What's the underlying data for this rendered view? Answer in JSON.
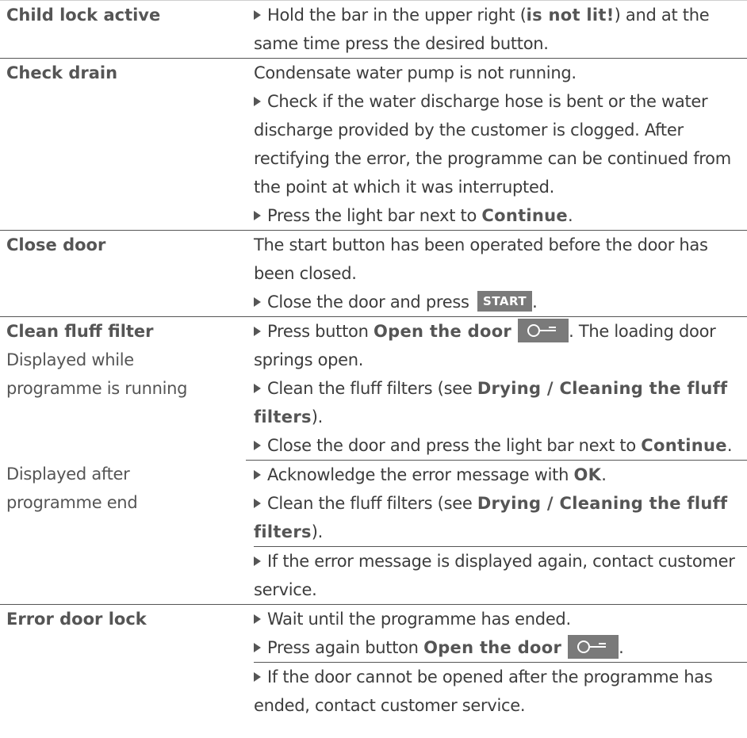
{
  "rows": [
    {
      "key": "child_lock",
      "left": [
        "Child lock active"
      ],
      "right": {
        "bullet1_pre": "Hold the bar in the upper right (",
        "bullet1_bold": "is not lit!",
        "bullet1_post": ") and at the",
        "cont1": "same time press the desired button."
      }
    },
    {
      "key": "check_drain",
      "left": [
        "Check drain"
      ],
      "right": {
        "intro": "Condensate water pump is not running.",
        "bullet1": "Check if the water discharge hose is bent or the water",
        "cont1": "discharge provided by the customer is clogged. After",
        "cont2": "rectifying the error, the programme can be continued from",
        "cont3": "the point at which it was interrupted.",
        "bullet2_pre": "Press the light bar next to ",
        "bullet2_bold": "Continue",
        "bullet2_post": "."
      }
    },
    {
      "key": "close_door",
      "left": [
        "Close door"
      ],
      "right": {
        "intro1": "The start button has been operated before the door has",
        "intro2": "been closed.",
        "bullet1_pre": "Close the door and press ",
        "start_label": "START",
        "bullet1_post": "."
      }
    },
    {
      "key": "clean_fluff",
      "left": [
        "Clean fluff filter",
        "Displayed while",
        "programme is running"
      ],
      "right": {
        "bullet1_pre": "Press button ",
        "bullet1_bold": "Open the door",
        "bullet1_post": ". The loading door",
        "cont1": "springs open.",
        "bullet2_pre": "Clean the fluff filters (see ",
        "bullet2_bold": "Drying / Cleaning the fluff",
        "cont2_bold": "filters",
        "cont2_post": ").",
        "bullet3_pre": "Close the door and press the light bar next to ",
        "bullet3_bold": "Continue",
        "bullet3_post": "."
      }
    },
    {
      "key": "after_end",
      "left": [
        "Displayed after",
        "programme end"
      ],
      "right": {
        "bullet1_pre": "Acknowledge the error message with ",
        "bullet1_bold": "OK",
        "bullet1_post": ".",
        "bullet2_pre": "Clean the fluff filters (see ",
        "bullet2_bold": "Drying / Cleaning the fluff",
        "cont2_bold": "filters",
        "cont2_post": ").",
        "bullet3": "If the error message is displayed again, contact customer",
        "cont3": "service."
      }
    },
    {
      "key": "error_door_lock",
      "left": [
        "Error door lock"
      ],
      "right": {
        "bullet1": "Wait until the programme has ended.",
        "bullet2_pre": "Press again button ",
        "bullet2_bold": "Open the door",
        "bullet2_post": ".",
        "bullet3": "If the door cannot be opened after the programme has",
        "cont3": "ended, contact customer service."
      }
    }
  ],
  "colors": {
    "text": "#3c3c3c",
    "bold_keyword": "#555555",
    "button_bg": "#7a7a7a",
    "rule": "#555555"
  },
  "icons": {
    "bullet": "triangle-right",
    "door_key": "key-icon"
  }
}
